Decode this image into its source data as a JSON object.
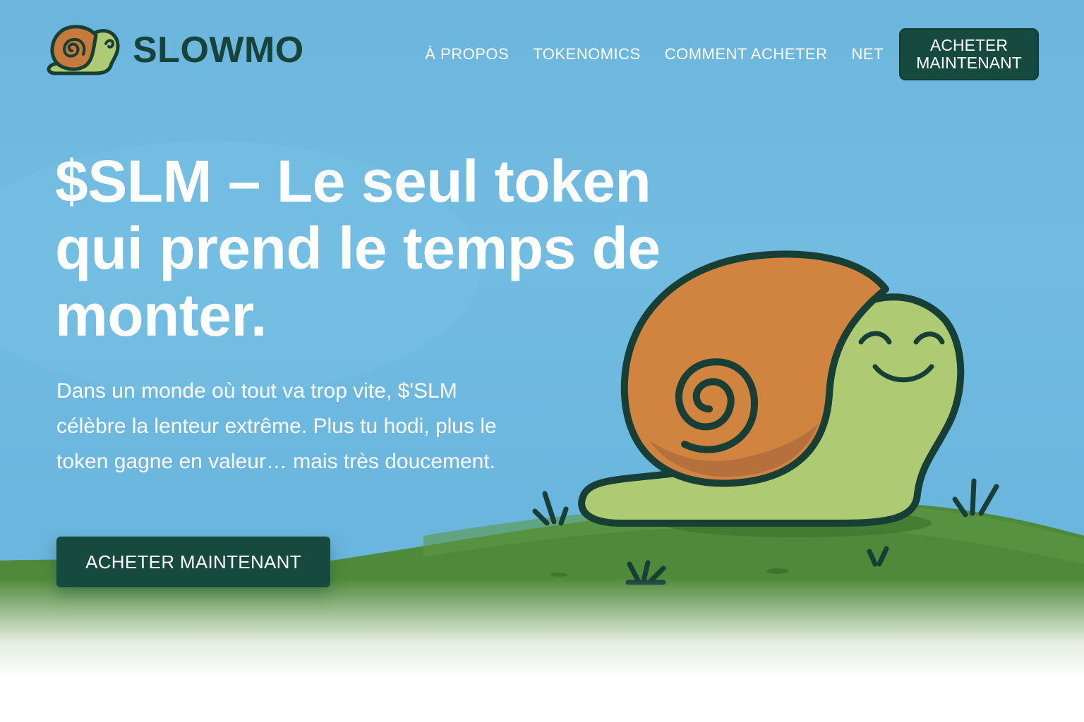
{
  "brand": {
    "name": "SLOWMO",
    "logo_icon": "snail-logo-icon"
  },
  "nav": {
    "links": [
      "À PROPOS",
      "TOKENOMICS",
      "COMMENT ACHETER",
      "NET"
    ],
    "button_label": "ACHETER MAINTENANT"
  },
  "hero": {
    "title": "$SLM – Le seul token qui prend le temps de monter.",
    "text": "Dans un monde où tout va trop vite, $'SLM célèbre la lenteur extrême. Plus tu hodi, plus le token gagne en valeur… mais très doucement.",
    "cta_label": "ACHETER MAINTENANT",
    "illustration": "snail-mascot-illustration"
  },
  "colors": {
    "sky": "#6cb6de",
    "grass": "#4f8a3a",
    "brand_dark": "#164a3f",
    "snail_body": "#aecb73",
    "snail_shell": "#d0843f"
  }
}
